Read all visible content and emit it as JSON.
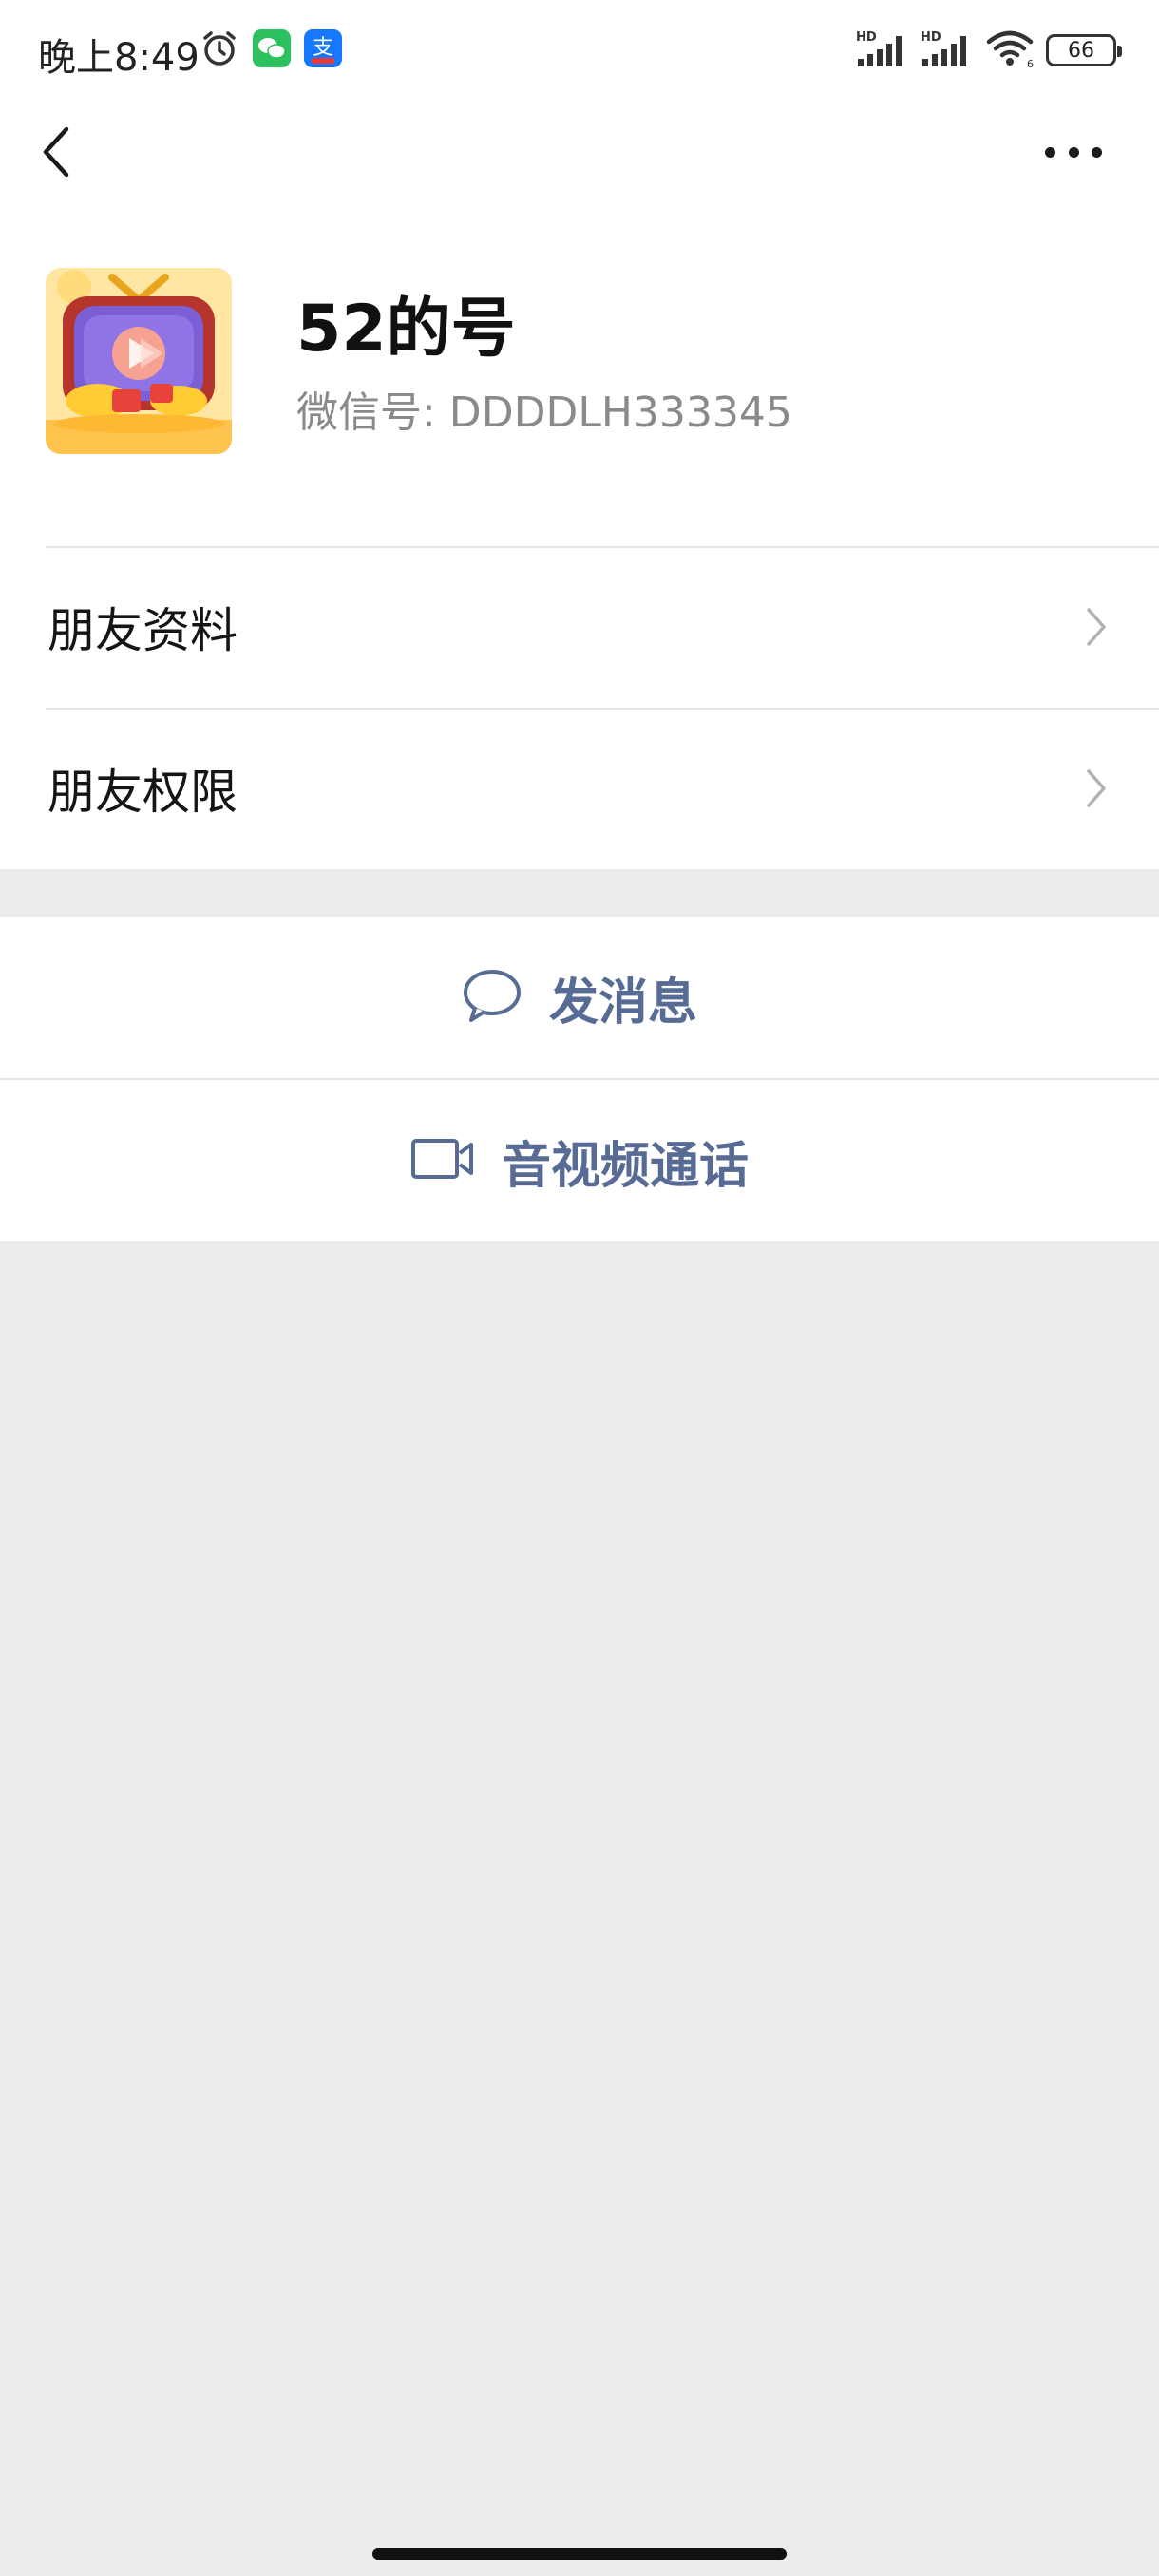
{
  "status_bar": {
    "time": "晚上8:49",
    "battery_level": "66",
    "network_label_1": "HD",
    "network_label_2": "HD",
    "icons": [
      "alarm-icon",
      "wechat-app-icon",
      "alipay-app-icon",
      "signal-icon",
      "signal-icon",
      "wifi-icon",
      "battery-icon"
    ]
  },
  "nav": {
    "back_icon": "chevron-left-icon",
    "more_icon": "more-dots-icon"
  },
  "profile": {
    "name": "52的号",
    "wechat_id": "微信号:  DDDDLH333345"
  },
  "menu": {
    "items": [
      {
        "label": "朋友资料"
      },
      {
        "label": "朋友权限"
      }
    ]
  },
  "actions": {
    "send_message": "发消息",
    "video_call": "音视频通话"
  },
  "colors": {
    "accent": "#576b95",
    "background": "#ededed",
    "surface": "#ffffff"
  }
}
